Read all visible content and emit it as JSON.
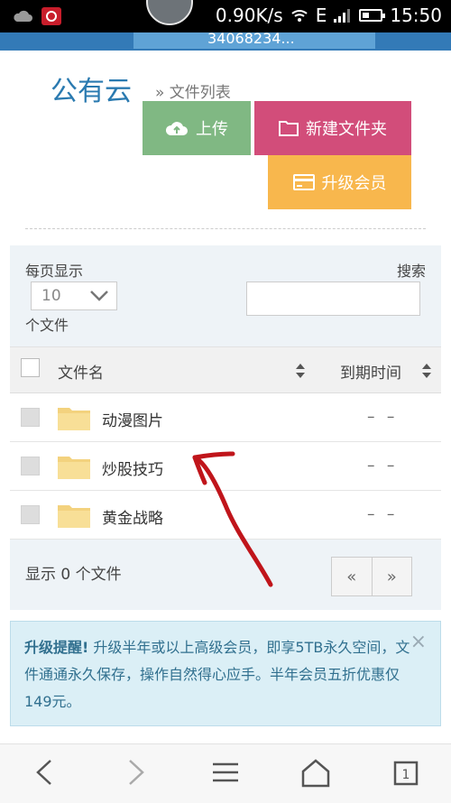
{
  "status_bar": {
    "network_speed": "0.90K/s",
    "network_type": "E",
    "time": "15:50"
  },
  "header": {
    "user_id_partial": "34068234..."
  },
  "page": {
    "title": "公有云",
    "breadcrumb": "» 文件列表"
  },
  "toolbar": {
    "upload_label": "上传",
    "new_folder_label": "新建文件夹",
    "upgrade_label": "升级会员"
  },
  "table_controls": {
    "per_page_label": "每页显示",
    "per_page_value": "10",
    "per_page_suffix": "个文件",
    "search_label": "搜索",
    "search_value": ""
  },
  "table": {
    "columns": [
      "文件名",
      "到期时间"
    ],
    "rows": [
      {
        "name": "动漫图片",
        "expiry": "– –"
      },
      {
        "name": "炒股技巧",
        "expiry": "– –"
      },
      {
        "name": "黄金战略",
        "expiry": "– –"
      }
    ]
  },
  "footer": {
    "showing_text": "显示 0 个文件",
    "prev_label": "«",
    "next_label": "»"
  },
  "alert": {
    "title": "升级提醒!",
    "message": "升级半年或以上高级会员，即享5TB永久空间，文件通通永久保存，操作自然得心应手。半年会员五折优惠仅149元。",
    "close_label": "×"
  },
  "colors": {
    "upload": "#80b883",
    "new_folder": "#d24d7a",
    "upgrade": "#f8b74d",
    "title": "#2a7ab0",
    "annotation": "#c0151b"
  }
}
